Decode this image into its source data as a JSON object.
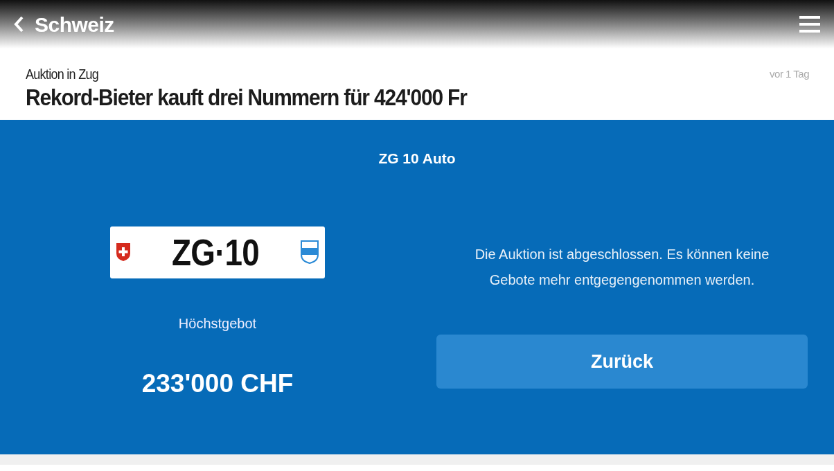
{
  "header": {
    "title": "Schweiz"
  },
  "article": {
    "kicker": "Auktion in Zug",
    "time": "vor 1 Tag",
    "title": "Rekord-Bieter kauft drei Nummern für 424'000 Fr"
  },
  "auction": {
    "title": "ZG 10 Auto",
    "plate": "ZG·10",
    "bid_label": "Höchstgebot",
    "bid": "233'000 CHF",
    "message": "Die Auktion ist abgeschlossen. Es können keine Gebote mehr entgegengenommen werden.",
    "button": "Zurück"
  }
}
